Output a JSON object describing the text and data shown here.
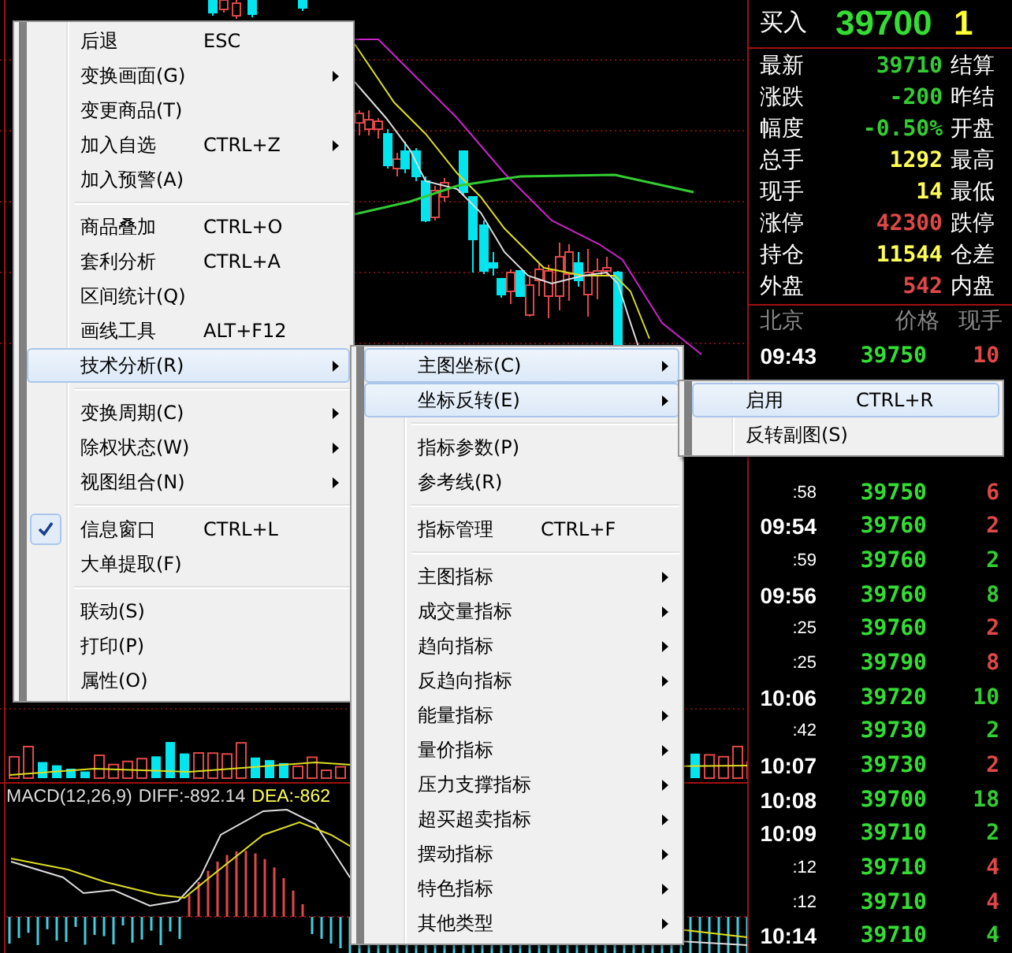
{
  "chart": {
    "macd": {
      "title": "MACD(12,26,9)",
      "diff": "DIFF:-892.14",
      "dea": "DEA:-862"
    }
  },
  "quote": {
    "bid_label": "买入",
    "bid_price": "39700",
    "bid_volume": "1",
    "rows": [
      {
        "label": "最新",
        "value": "39710",
        "color": "#33cc33",
        "right_label": "结算"
      },
      {
        "label": "涨跌",
        "value": "-200",
        "color": "#33cc33",
        "right_label": "昨结"
      },
      {
        "label": "幅度",
        "value": "-0.50%",
        "color": "#33cc33",
        "right_label": "开盘"
      },
      {
        "label": "总手",
        "value": "1292",
        "color": "#ffff55",
        "right_label": "最高"
      },
      {
        "label": "现手",
        "value": "14",
        "color": "#ffff55",
        "right_label": "最低"
      },
      {
        "label": "涨停",
        "value": "42300",
        "color": "#e04848",
        "right_label": "跌停"
      },
      {
        "label": "持仓",
        "value": "11544",
        "color": "#ffff55",
        "right_label": "仓差"
      },
      {
        "label": "外盘",
        "value": "542",
        "color": "#e04848",
        "right_label": "内盘"
      }
    ]
  },
  "ticks": {
    "columns": [
      "北京",
      "价格",
      "现手"
    ],
    "first": {
      "kind": "full",
      "time": "09:43",
      "price": "39750",
      "volume": "10",
      "color": "#e04848"
    },
    "rows": [
      {
        "kind": "short",
        "time": ":58",
        "price": "39750",
        "volume": "6",
        "color": "#e04848"
      },
      {
        "kind": "full",
        "time": "09:54",
        "price": "39760",
        "volume": "2",
        "color": "#e04848"
      },
      {
        "kind": "short",
        "time": ":59",
        "price": "39760",
        "volume": "2",
        "color": "#33cc33"
      },
      {
        "kind": "full",
        "time": "09:56",
        "price": "39760",
        "volume": "8",
        "color": "#33cc33"
      },
      {
        "kind": "short",
        "time": ":25",
        "price": "39760",
        "volume": "2",
        "color": "#e04848"
      },
      {
        "kind": "short",
        "time": ":25",
        "price": "39790",
        "volume": "8",
        "color": "#e04848"
      },
      {
        "kind": "full",
        "time": "10:06",
        "price": "39720",
        "volume": "10",
        "color": "#33cc33"
      },
      {
        "kind": "short",
        "time": ":42",
        "price": "39730",
        "volume": "2",
        "color": "#33cc33"
      },
      {
        "kind": "full",
        "time": "10:07",
        "price": "39730",
        "volume": "2",
        "color": "#e04848"
      },
      {
        "kind": "full",
        "time": "10:08",
        "price": "39700",
        "volume": "18",
        "color": "#33cc33"
      },
      {
        "kind": "full",
        "time": "10:09",
        "price": "39710",
        "volume": "2",
        "color": "#33cc33"
      },
      {
        "kind": "short",
        "time": ":12",
        "price": "39710",
        "volume": "4",
        "color": "#e04848"
      },
      {
        "kind": "short",
        "time": ":12",
        "price": "39710",
        "volume": "4",
        "color": "#e04848"
      },
      {
        "kind": "full",
        "time": "10:14",
        "price": "39710",
        "volume": "4",
        "color": "#33cc33"
      }
    ]
  },
  "context_menu": {
    "items": [
      {
        "kind": "item",
        "label": "后退",
        "shortcut": "ESC",
        "submenu": false,
        "selected": false,
        "checked": false
      },
      {
        "kind": "item",
        "label": "变换画面(G)",
        "submenu": true,
        "selected": false,
        "checked": false
      },
      {
        "kind": "item",
        "label": "变更商品(T)",
        "submenu": false,
        "selected": false,
        "checked": false
      },
      {
        "kind": "item",
        "label": "加入自选",
        "shortcut": "CTRL+Z",
        "submenu": true,
        "selected": false,
        "checked": false
      },
      {
        "kind": "item",
        "label": "加入预警(A)",
        "submenu": false,
        "selected": false,
        "checked": false
      },
      {
        "kind": "separator"
      },
      {
        "kind": "item",
        "label": "商品叠加",
        "shortcut": "CTRL+O",
        "submenu": false,
        "selected": false,
        "checked": false
      },
      {
        "kind": "item",
        "label": "套利分析",
        "shortcut": "CTRL+A",
        "submenu": false,
        "selected": false,
        "checked": false
      },
      {
        "kind": "item",
        "label": "区间统计(Q)",
        "submenu": false,
        "selected": false,
        "checked": false
      },
      {
        "kind": "item",
        "label": "画线工具",
        "shortcut": "ALT+F12",
        "submenu": false,
        "selected": false,
        "checked": false
      },
      {
        "kind": "item",
        "label": "技术分析(R)",
        "submenu": true,
        "selected": true,
        "checked": false
      },
      {
        "kind": "separator"
      },
      {
        "kind": "item",
        "label": "变换周期(C)",
        "submenu": true,
        "selected": false,
        "checked": false
      },
      {
        "kind": "item",
        "label": "除权状态(W)",
        "submenu": true,
        "selected": false,
        "checked": false
      },
      {
        "kind": "item",
        "label": "视图组合(N)",
        "submenu": true,
        "selected": false,
        "checked": false
      },
      {
        "kind": "separator"
      },
      {
        "kind": "item",
        "label": "信息窗口",
        "shortcut": "CTRL+L",
        "submenu": false,
        "selected": false,
        "checked": true
      },
      {
        "kind": "item",
        "label": "大单提取(F)",
        "submenu": false,
        "selected": false,
        "checked": false
      },
      {
        "kind": "separator"
      },
      {
        "kind": "item",
        "label": "联动(S)",
        "submenu": false,
        "selected": false,
        "checked": false
      },
      {
        "kind": "item",
        "label": "打印(P)",
        "submenu": false,
        "selected": false,
        "checked": false
      },
      {
        "kind": "item",
        "label": "属性(O)",
        "submenu": false,
        "selected": false,
        "checked": false
      }
    ]
  },
  "analysis_submenu": {
    "items": [
      {
        "kind": "item",
        "label": "主图坐标(C)",
        "submenu": true,
        "selected": true
      },
      {
        "kind": "item",
        "label": "坐标反转(E)",
        "submenu": true,
        "selected": true
      },
      {
        "kind": "separator"
      },
      {
        "kind": "item",
        "label": "指标参数(P)",
        "submenu": false,
        "selected": false
      },
      {
        "kind": "item",
        "label": "参考线(R)",
        "submenu": false,
        "selected": false
      },
      {
        "kind": "separator"
      },
      {
        "kind": "item",
        "label": "指标管理",
        "shortcut": "CTRL+F",
        "submenu": false,
        "selected": false
      },
      {
        "kind": "separator"
      },
      {
        "kind": "item",
        "label": "主图指标",
        "submenu": true,
        "selected": false
      },
      {
        "kind": "item",
        "label": "成交量指标",
        "submenu": true,
        "selected": false
      },
      {
        "kind": "item",
        "label": "趋向指标",
        "submenu": true,
        "selected": false
      },
      {
        "kind": "item",
        "label": "反趋向指标",
        "submenu": true,
        "selected": false
      },
      {
        "kind": "item",
        "label": "能量指标",
        "submenu": true,
        "selected": false
      },
      {
        "kind": "item",
        "label": "量价指标",
        "submenu": true,
        "selected": false
      },
      {
        "kind": "item",
        "label": "压力支撑指标",
        "submenu": true,
        "selected": false
      },
      {
        "kind": "item",
        "label": "超买超卖指标",
        "submenu": true,
        "selected": false
      },
      {
        "kind": "item",
        "label": "摆动指标",
        "submenu": true,
        "selected": false
      },
      {
        "kind": "item",
        "label": "特色指标",
        "submenu": true,
        "selected": false
      },
      {
        "kind": "item",
        "label": "其他类型",
        "submenu": true,
        "selected": false
      }
    ]
  },
  "invert_submenu": {
    "items": [
      {
        "kind": "item",
        "label": "启用",
        "shortcut": "CTRL+R",
        "submenu": false,
        "selected": true
      },
      {
        "kind": "item",
        "label": "反转副图(S)",
        "submenu": false,
        "selected": false
      }
    ]
  }
}
